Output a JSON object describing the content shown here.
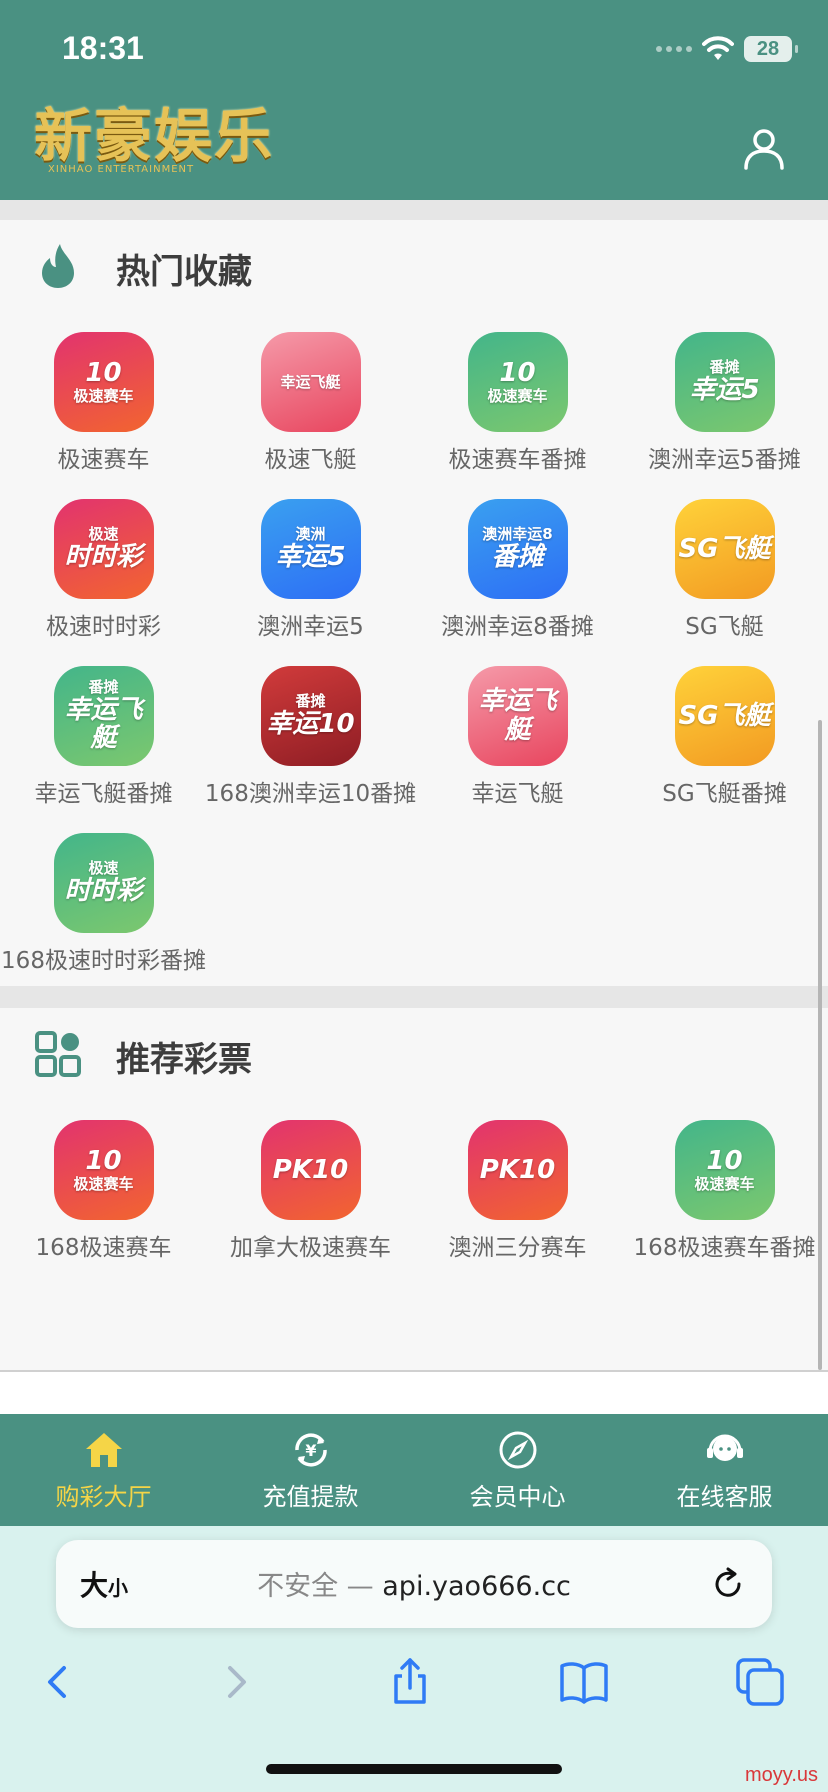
{
  "status_bar": {
    "time": "18:31",
    "battery": "28"
  },
  "header": {
    "brand": "新豪娱乐",
    "brand_sub": "XINHAO ENTERTAINMENT"
  },
  "sections": {
    "hot": {
      "title": "热门收藏",
      "items": [
        {
          "label": "极速赛车",
          "logo_text": "10",
          "logo_sub": "极速赛车",
          "color": "red"
        },
        {
          "label": "极速飞艇",
          "logo_text": "",
          "logo_sub": "幸运飞艇",
          "color": "pink"
        },
        {
          "label": "极速赛车番摊",
          "logo_text": "10",
          "logo_sub": "极速赛车",
          "color": "green"
        },
        {
          "label": "澳洲幸运5番摊",
          "logo_text": "番摊",
          "logo_sub": "幸运5",
          "color": "green"
        },
        {
          "label": "极速时时彩",
          "logo_text": "极速",
          "logo_sub": "时时彩",
          "color": "red"
        },
        {
          "label": "澳洲幸运5",
          "logo_text": "澳洲",
          "logo_sub": "幸运5",
          "color": "blue"
        },
        {
          "label": "澳洲幸运8番摊",
          "logo_text": "澳洲幸运8",
          "logo_sub": "番摊",
          "color": "blue"
        },
        {
          "label": "SG飞艇",
          "logo_text": "",
          "logo_sub": "SG飞艇",
          "color": "yellow"
        },
        {
          "label": "幸运飞艇番摊",
          "logo_text": "番摊",
          "logo_sub": "幸运飞艇",
          "color": "green"
        },
        {
          "label": "168澳洲幸运10番摊",
          "logo_text": "番摊",
          "logo_sub": "幸运10",
          "color": "darkred"
        },
        {
          "label": "幸运飞艇",
          "logo_text": "",
          "logo_sub": "幸运飞艇",
          "color": "pink"
        },
        {
          "label": "SG飞艇番摊",
          "logo_text": "",
          "logo_sub": "SG飞艇",
          "color": "yellow"
        },
        {
          "label": "168极速时时彩番摊",
          "logo_text": "极速",
          "logo_sub": "时时彩",
          "color": "green"
        }
      ]
    },
    "recommended": {
      "title": "推荐彩票",
      "items": [
        {
          "label": "168极速赛车",
          "logo_text": "10",
          "logo_sub": "极速赛车",
          "color": "red"
        },
        {
          "label": "加拿大极速赛车",
          "logo_text": "PK10",
          "logo_sub": "",
          "color": "red"
        },
        {
          "label": "澳洲三分赛车",
          "logo_text": "PK10",
          "logo_sub": "",
          "color": "red"
        },
        {
          "label": "168极速赛车番摊",
          "logo_text": "10",
          "logo_sub": "极速赛车",
          "color": "green"
        }
      ]
    }
  },
  "bottom_nav": [
    {
      "label": "购彩大厅",
      "icon": "home-icon",
      "active": true
    },
    {
      "label": "充值提款",
      "icon": "yen-exchange-icon",
      "active": false
    },
    {
      "label": "会员中心",
      "icon": "compass-icon",
      "active": false
    },
    {
      "label": "在线客服",
      "icon": "headset-icon",
      "active": false
    }
  ],
  "browser": {
    "aa_big": "大",
    "aa_small": "小",
    "insecure": "不安全 — ",
    "domain": "api.yao666.cc"
  },
  "watermark": "moyy.us",
  "colors": {
    "header": "#4a9182",
    "accent_active": "#f5d547",
    "brand_gold": "#e6c257"
  }
}
